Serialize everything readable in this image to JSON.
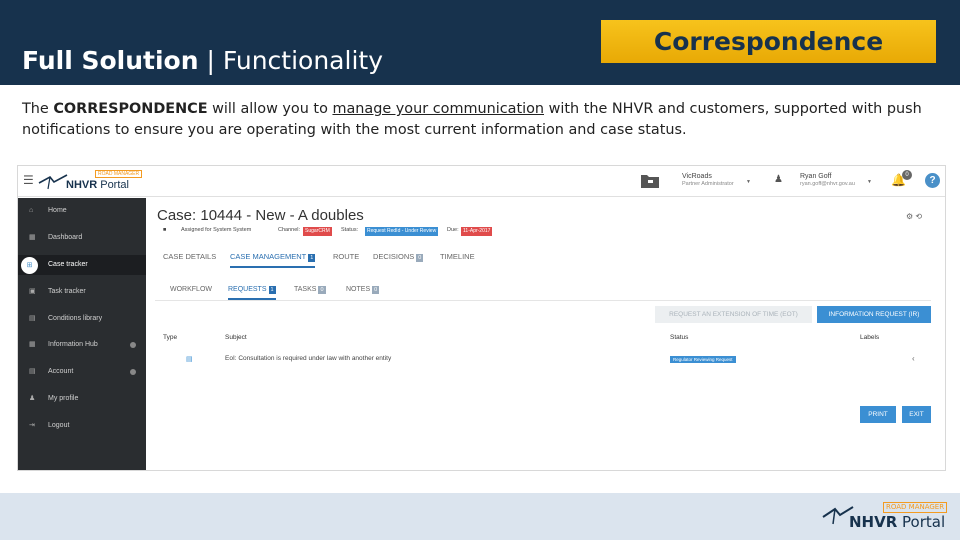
{
  "slide": {
    "title_bold": "Full Solution",
    "title_sep": " | ",
    "title_rest": "Functionality",
    "badge": "Correspondence",
    "intro_pre": "The ",
    "intro_bold": "CORRESPONDENCE",
    "intro_mid": " will allow you to ",
    "intro_underline": "manage your communication",
    "intro_post": " with the NHVR and customers, supported with push notifications to ensure you are operating with the most current information and case status."
  },
  "portal": {
    "logo_tag": "ROAD MANAGER",
    "logo_name": "NHVR",
    "logo_suffix": " Portal",
    "org_name": "VicRoads",
    "org_role": "Partner Administrator",
    "user_name": "Ryan Goff",
    "user_email": "ryan.goff@nhvr.gov.au",
    "bell_count": "0",
    "help": "?"
  },
  "sidebar": {
    "items": [
      {
        "label": "Home",
        "icon": "home-icon",
        "glyph": "⌂"
      },
      {
        "label": "Dashboard",
        "icon": "dashboard-icon",
        "glyph": "▦"
      },
      {
        "label": "Case tracker",
        "icon": "case-tracker-icon",
        "glyph": "⊞"
      },
      {
        "label": "Task tracker",
        "icon": "task-tracker-icon",
        "glyph": "▣"
      },
      {
        "label": "Conditions library",
        "icon": "library-icon",
        "glyph": "▤"
      },
      {
        "label": "Information Hub",
        "icon": "info-hub-icon",
        "glyph": "▦"
      },
      {
        "label": "Account",
        "icon": "account-icon",
        "glyph": "▤"
      },
      {
        "label": "My profile",
        "icon": "profile-icon",
        "glyph": "♟"
      },
      {
        "label": "Logout",
        "icon": "logout-icon",
        "glyph": "⇥"
      }
    ]
  },
  "case": {
    "title": "Case: 10444 - New - A doubles",
    "assigned": "Assigned for System System",
    "channel_label": "Channel:",
    "channel_value": "SugarCRM",
    "status_label": "Status:",
    "status_value": "Request RedId - Under Review",
    "due_label": "Due:",
    "due_value": "11-Apr-2017",
    "actions": "⚙ ⟲"
  },
  "tabs": [
    {
      "label": "CASE DETAILS",
      "count": ""
    },
    {
      "label": "CASE MANAGEMENT",
      "count": "1"
    },
    {
      "label": "ROUTE",
      "count": ""
    },
    {
      "label": "DECISIONS",
      "count": "0"
    },
    {
      "label": "TIMELINE",
      "count": ""
    }
  ],
  "subtabs": [
    {
      "label": "WORKFLOW",
      "count": ""
    },
    {
      "label": "REQUESTS",
      "count": "1"
    },
    {
      "label": "TASKS",
      "count": "0"
    },
    {
      "label": "NOTES",
      "count": "0"
    }
  ],
  "buttons": {
    "eot": "REQUEST AN EXTENSION OF TIME (EOT)",
    "ir": "INFORMATION REQUEST (IR)",
    "print": "PRINT",
    "exit": "EXIT"
  },
  "table": {
    "headers": [
      "Type",
      "Subject",
      "Status",
      "Labels"
    ],
    "rows": [
      {
        "type_icon": "document-icon",
        "subject": "EoI: Consultation is required under law with another entity",
        "status": "Regulator Reviewing Request"
      }
    ]
  },
  "footer": {
    "logo_tag": "ROAD MANAGER",
    "logo_name": "NHVR",
    "logo_suffix": " Portal"
  },
  "colors": {
    "header_navy": "#17324d",
    "badge_gold": "#f3b814",
    "accent_blue": "#3b8fd3",
    "sidebar_dark": "#2a2d30",
    "chip_red": "#e04b4b"
  }
}
